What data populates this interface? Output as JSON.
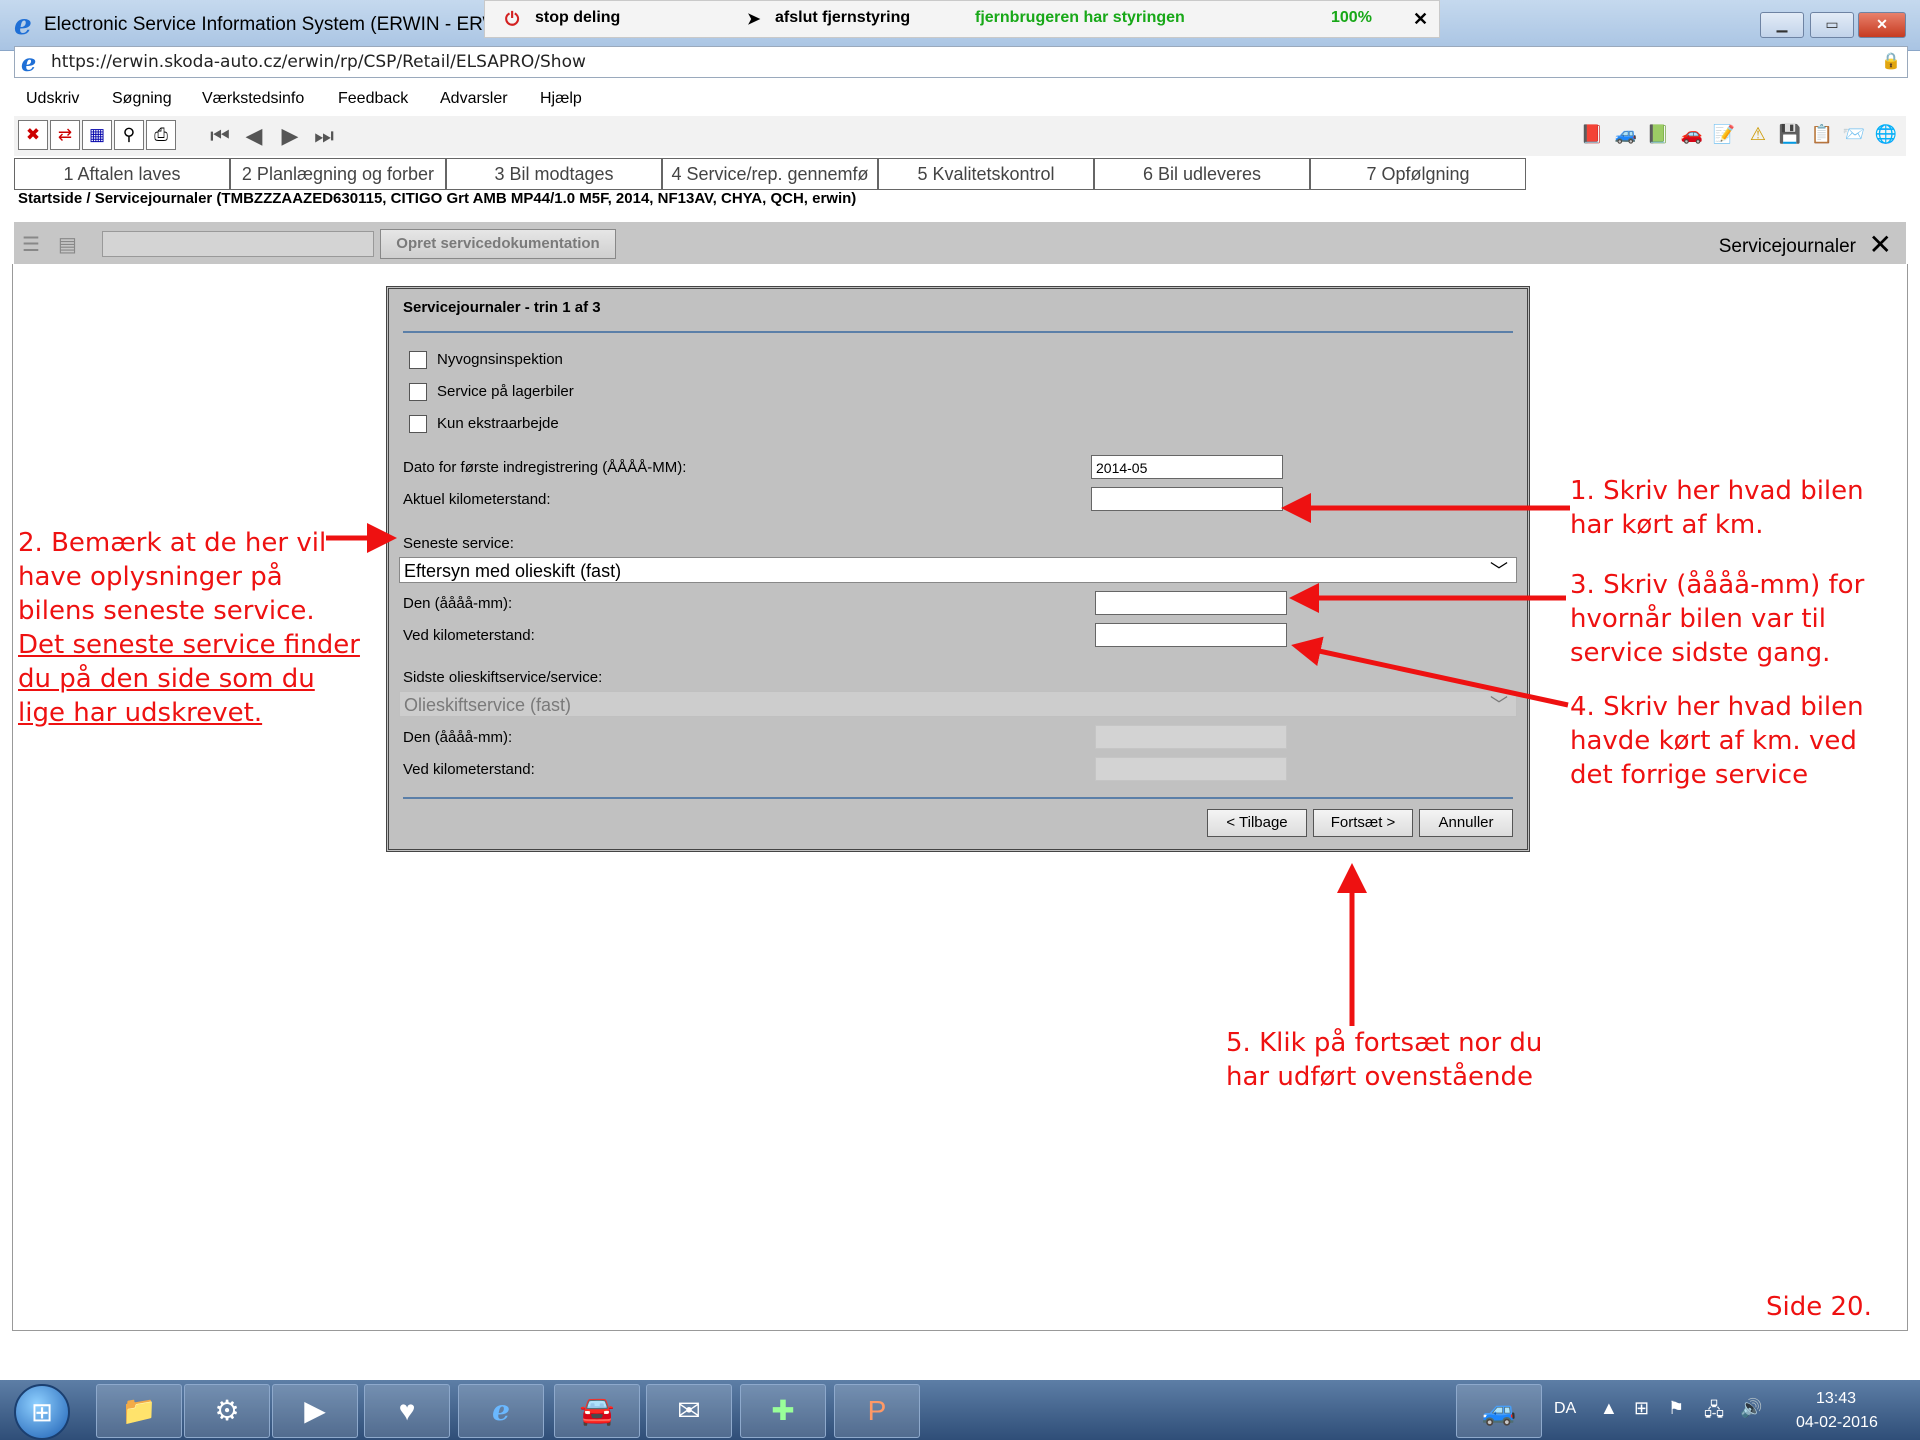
{
  "window": {
    "title": "Electronic Service Information System (ERWIN - ERWIN)",
    "url": "https://erwin.skoda-auto.cz/erwin/rp/CSP/Retail/ELSAPRO/Show"
  },
  "share_bar": {
    "stop_label": "stop deling",
    "end_label": "afslut fjernstyring",
    "status": "fjernbrugeren har styringen",
    "zoom": "100%"
  },
  "menu": [
    "Udskriv",
    "Søgning",
    "Værkstedsinfo",
    "Feedback",
    "Advarsler",
    "Hjælp"
  ],
  "tabs": [
    "1 Aftalen laves",
    "2 Planlægning og forber",
    "3 Bil modtages",
    "4 Service/rep. gennemfø",
    "5 Kvalitetskontrol",
    "6 Bil udleveres",
    "7 Opfølgning"
  ],
  "breadcrumb": "Startside / Servicejournaler (TMBZZZAAZED630115, CITIGO Grt AMB MP44/1.0 M5F, 2014, NF13AV, CHYA, QCH, erwin)",
  "actionbar": {
    "create_button": "Opret servicedokumentation",
    "panel_title": "Servicejournaler"
  },
  "dialog": {
    "title": "Servicejournaler - trin 1 af 3",
    "checkboxes": [
      "Nyvognsinspektion",
      "Service på lagerbiler",
      "Kun ekstraarbejde"
    ],
    "first_reg_label": "Dato for første indregistrering (ÅÅÅÅ-MM):",
    "first_reg_value": "2014-05",
    "mileage_label": "Aktuel kilometerstand:",
    "last_service_label": "Seneste service:",
    "last_service_value": "Eftersyn med olieskift (fast)",
    "date_label": "Den (åååå-mm):",
    "km_label": "Ved kilometerstand:",
    "last_oil_label": "Sidste olieskiftservice/service:",
    "last_oil_value": "Olieskiftservice (fast)",
    "date_label_2": "Den (åååå-mm):",
    "km_label_2": "Ved kilometerstand:",
    "btn_back": "< Tilbage",
    "btn_next": "Fortsæt >",
    "btn_cancel": "Annuller"
  },
  "annotations": {
    "note1": [
      "1. Skriv her hvad bilen",
      "har kørt af km."
    ],
    "note2": [
      "2. Bemærk at de her vil",
      "have oplysninger på",
      "bilens seneste service."
    ],
    "note2_underlined": [
      "Det seneste service finder",
      "du på den side som du",
      "lige har udskrevet."
    ],
    "note3": [
      "3. Skriv (åååå-mm) for",
      "hvornår bilen var til",
      "service sidste gang."
    ],
    "note4": [
      "4. Skriv her hvad bilen",
      "havde kørt af km. ved",
      "det forrige service"
    ],
    "note5": [
      "5. Klik på fortsæt nor du",
      "har udført ovenstående"
    ],
    "page": "Side 20.",
    "color": "#ee1111"
  },
  "taskbar": {
    "language": "DA",
    "time": "13:43",
    "date": "04-02-2016"
  }
}
